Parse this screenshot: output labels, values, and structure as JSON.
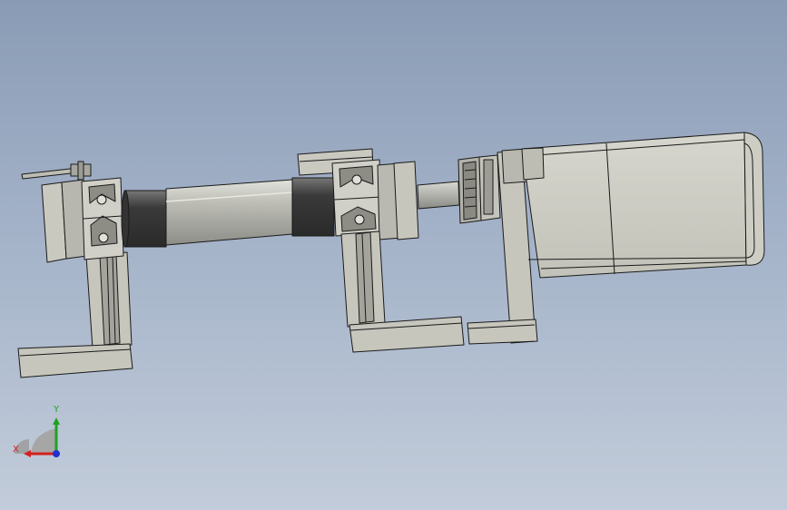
{
  "viewport": {
    "background_top": "#8a9bb5",
    "background_bottom": "#c2ccda"
  },
  "model": {
    "part_fill": "#c6c6bd",
    "part_dark": "#9a9a92",
    "edge_color": "#1a1a1a",
    "motor_fill": "#cfcfc6",
    "tube_fill": "#b5b5ae",
    "rod_fill": "#a9a9a3"
  },
  "triad": {
    "x_label": "X",
    "y_label": "Y",
    "x_color": "#d42020",
    "y_color": "#1fa31f",
    "z_color": "#2030d0",
    "icon": "coordinate-triad-icon"
  }
}
